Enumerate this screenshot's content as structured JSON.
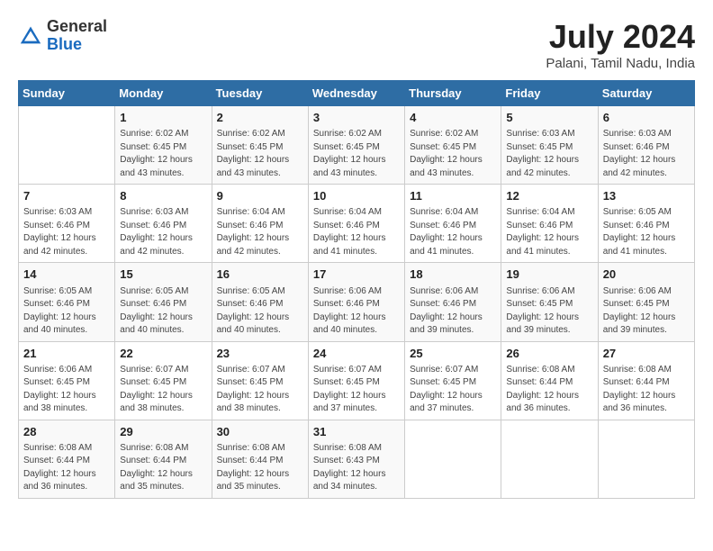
{
  "header": {
    "logo_general": "General",
    "logo_blue": "Blue",
    "month_title": "July 2024",
    "location": "Palani, Tamil Nadu, India"
  },
  "weekdays": [
    "Sunday",
    "Monday",
    "Tuesday",
    "Wednesday",
    "Thursday",
    "Friday",
    "Saturday"
  ],
  "weeks": [
    [
      {
        "num": "",
        "info": ""
      },
      {
        "num": "1",
        "info": "Sunrise: 6:02 AM\nSunset: 6:45 PM\nDaylight: 12 hours\nand 43 minutes."
      },
      {
        "num": "2",
        "info": "Sunrise: 6:02 AM\nSunset: 6:45 PM\nDaylight: 12 hours\nand 43 minutes."
      },
      {
        "num": "3",
        "info": "Sunrise: 6:02 AM\nSunset: 6:45 PM\nDaylight: 12 hours\nand 43 minutes."
      },
      {
        "num": "4",
        "info": "Sunrise: 6:02 AM\nSunset: 6:45 PM\nDaylight: 12 hours\nand 43 minutes."
      },
      {
        "num": "5",
        "info": "Sunrise: 6:03 AM\nSunset: 6:45 PM\nDaylight: 12 hours\nand 42 minutes."
      },
      {
        "num": "6",
        "info": "Sunrise: 6:03 AM\nSunset: 6:46 PM\nDaylight: 12 hours\nand 42 minutes."
      }
    ],
    [
      {
        "num": "7",
        "info": "Sunrise: 6:03 AM\nSunset: 6:46 PM\nDaylight: 12 hours\nand 42 minutes."
      },
      {
        "num": "8",
        "info": "Sunrise: 6:03 AM\nSunset: 6:46 PM\nDaylight: 12 hours\nand 42 minutes."
      },
      {
        "num": "9",
        "info": "Sunrise: 6:04 AM\nSunset: 6:46 PM\nDaylight: 12 hours\nand 42 minutes."
      },
      {
        "num": "10",
        "info": "Sunrise: 6:04 AM\nSunset: 6:46 PM\nDaylight: 12 hours\nand 41 minutes."
      },
      {
        "num": "11",
        "info": "Sunrise: 6:04 AM\nSunset: 6:46 PM\nDaylight: 12 hours\nand 41 minutes."
      },
      {
        "num": "12",
        "info": "Sunrise: 6:04 AM\nSunset: 6:46 PM\nDaylight: 12 hours\nand 41 minutes."
      },
      {
        "num": "13",
        "info": "Sunrise: 6:05 AM\nSunset: 6:46 PM\nDaylight: 12 hours\nand 41 minutes."
      }
    ],
    [
      {
        "num": "14",
        "info": "Sunrise: 6:05 AM\nSunset: 6:46 PM\nDaylight: 12 hours\nand 40 minutes."
      },
      {
        "num": "15",
        "info": "Sunrise: 6:05 AM\nSunset: 6:46 PM\nDaylight: 12 hours\nand 40 minutes."
      },
      {
        "num": "16",
        "info": "Sunrise: 6:05 AM\nSunset: 6:46 PM\nDaylight: 12 hours\nand 40 minutes."
      },
      {
        "num": "17",
        "info": "Sunrise: 6:06 AM\nSunset: 6:46 PM\nDaylight: 12 hours\nand 40 minutes."
      },
      {
        "num": "18",
        "info": "Sunrise: 6:06 AM\nSunset: 6:46 PM\nDaylight: 12 hours\nand 39 minutes."
      },
      {
        "num": "19",
        "info": "Sunrise: 6:06 AM\nSunset: 6:45 PM\nDaylight: 12 hours\nand 39 minutes."
      },
      {
        "num": "20",
        "info": "Sunrise: 6:06 AM\nSunset: 6:45 PM\nDaylight: 12 hours\nand 39 minutes."
      }
    ],
    [
      {
        "num": "21",
        "info": "Sunrise: 6:06 AM\nSunset: 6:45 PM\nDaylight: 12 hours\nand 38 minutes."
      },
      {
        "num": "22",
        "info": "Sunrise: 6:07 AM\nSunset: 6:45 PM\nDaylight: 12 hours\nand 38 minutes."
      },
      {
        "num": "23",
        "info": "Sunrise: 6:07 AM\nSunset: 6:45 PM\nDaylight: 12 hours\nand 38 minutes."
      },
      {
        "num": "24",
        "info": "Sunrise: 6:07 AM\nSunset: 6:45 PM\nDaylight: 12 hours\nand 37 minutes."
      },
      {
        "num": "25",
        "info": "Sunrise: 6:07 AM\nSunset: 6:45 PM\nDaylight: 12 hours\nand 37 minutes."
      },
      {
        "num": "26",
        "info": "Sunrise: 6:08 AM\nSunset: 6:44 PM\nDaylight: 12 hours\nand 36 minutes."
      },
      {
        "num": "27",
        "info": "Sunrise: 6:08 AM\nSunset: 6:44 PM\nDaylight: 12 hours\nand 36 minutes."
      }
    ],
    [
      {
        "num": "28",
        "info": "Sunrise: 6:08 AM\nSunset: 6:44 PM\nDaylight: 12 hours\nand 36 minutes."
      },
      {
        "num": "29",
        "info": "Sunrise: 6:08 AM\nSunset: 6:44 PM\nDaylight: 12 hours\nand 35 minutes."
      },
      {
        "num": "30",
        "info": "Sunrise: 6:08 AM\nSunset: 6:44 PM\nDaylight: 12 hours\nand 35 minutes."
      },
      {
        "num": "31",
        "info": "Sunrise: 6:08 AM\nSunset: 6:43 PM\nDaylight: 12 hours\nand 34 minutes."
      },
      {
        "num": "",
        "info": ""
      },
      {
        "num": "",
        "info": ""
      },
      {
        "num": "",
        "info": ""
      }
    ]
  ]
}
